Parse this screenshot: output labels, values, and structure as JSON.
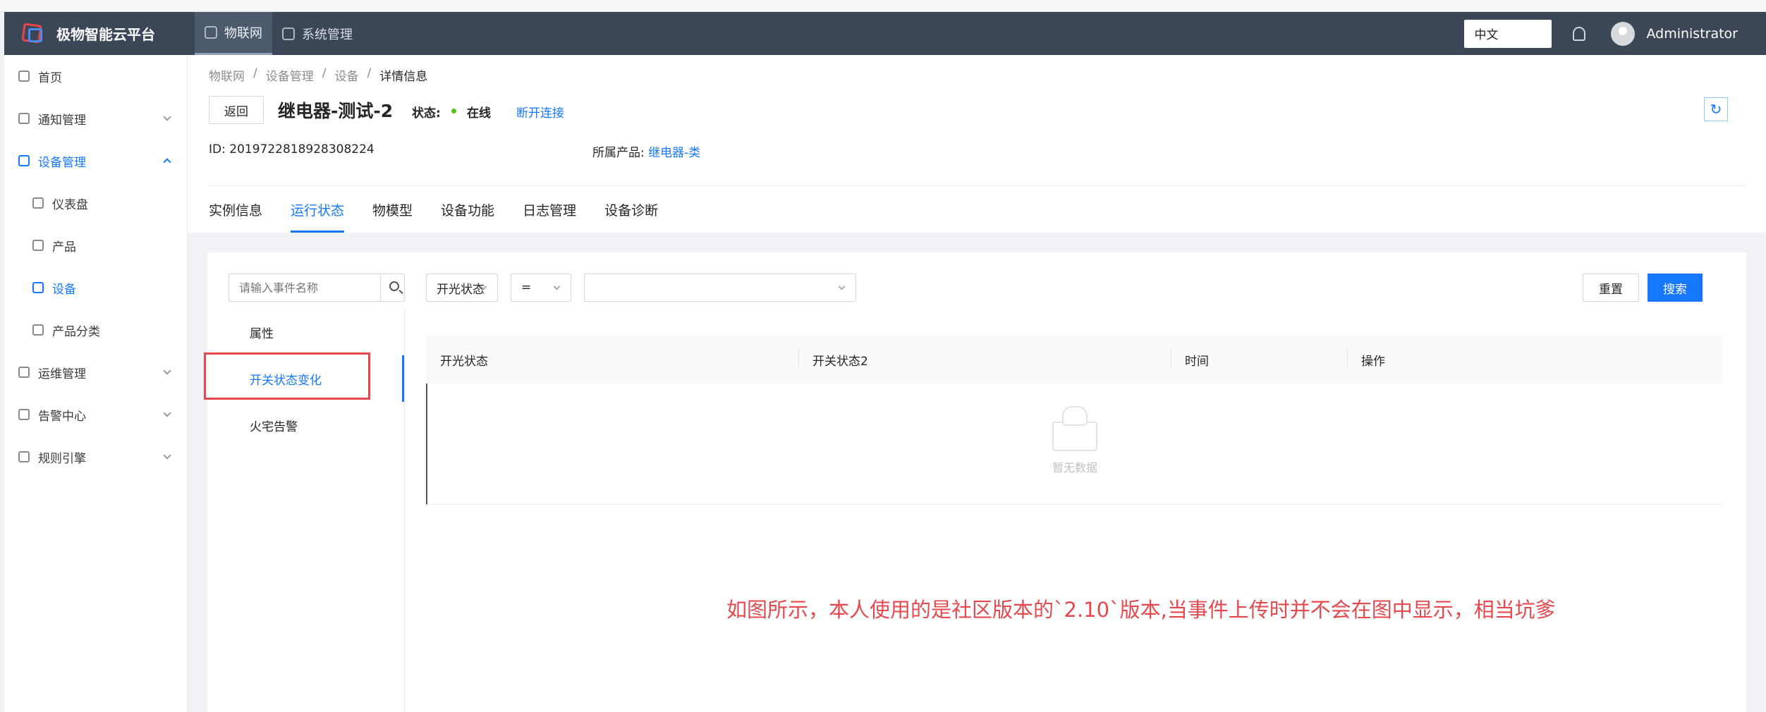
{
  "app": {
    "title": "极物智能云平台"
  },
  "topnav": [
    {
      "label": "物联网"
    },
    {
      "label": "系统管理"
    }
  ],
  "header": {
    "language": "中文",
    "user": "Administrator"
  },
  "sidebar": {
    "items": [
      {
        "label": "首页"
      },
      {
        "label": "通知管理"
      },
      {
        "label": "设备管理"
      },
      {
        "label": "仪表盘"
      },
      {
        "label": "产品"
      },
      {
        "label": "设备"
      },
      {
        "label": "产品分类"
      },
      {
        "label": "运维管理"
      },
      {
        "label": "告警中心"
      },
      {
        "label": "规则引擎"
      }
    ]
  },
  "breadcrumb": [
    "物联网",
    "/",
    "设备管理",
    "/",
    "设备",
    "/",
    "详情信息"
  ],
  "device": {
    "back": "返回",
    "name": "继电器-测试-2",
    "status_label": "状态:",
    "status_value": "在线",
    "disconnect": "断开连接",
    "id_label": "ID:",
    "id_value": "2019722818928308224",
    "product_label": "所属产品:",
    "product_value": "继电器-类"
  },
  "tabs": [
    "实例信息",
    "运行状态",
    "物模型",
    "设备功能",
    "日志管理",
    "设备诊断"
  ],
  "events": {
    "search_placeholder": "请输入事件名称",
    "items": [
      "属性",
      "开关状态变化",
      "火宅告警"
    ]
  },
  "filters": {
    "field": "开光状态",
    "operator": "=",
    "value": "",
    "reset": "重置",
    "search": "搜索"
  },
  "table": {
    "columns": [
      "开光状态",
      "开关状态2",
      "时间",
      "操作"
    ],
    "empty": "暂无数据"
  },
  "annotation": "如图所示，本人使用的是社区版本的`2.10`版本,当事件上传时并不会在图中显示，相当坑爹",
  "colors": {
    "primary": "#1677ff",
    "header": "#3b4657",
    "online": "#52c41a",
    "annotation": "#e5484d"
  }
}
